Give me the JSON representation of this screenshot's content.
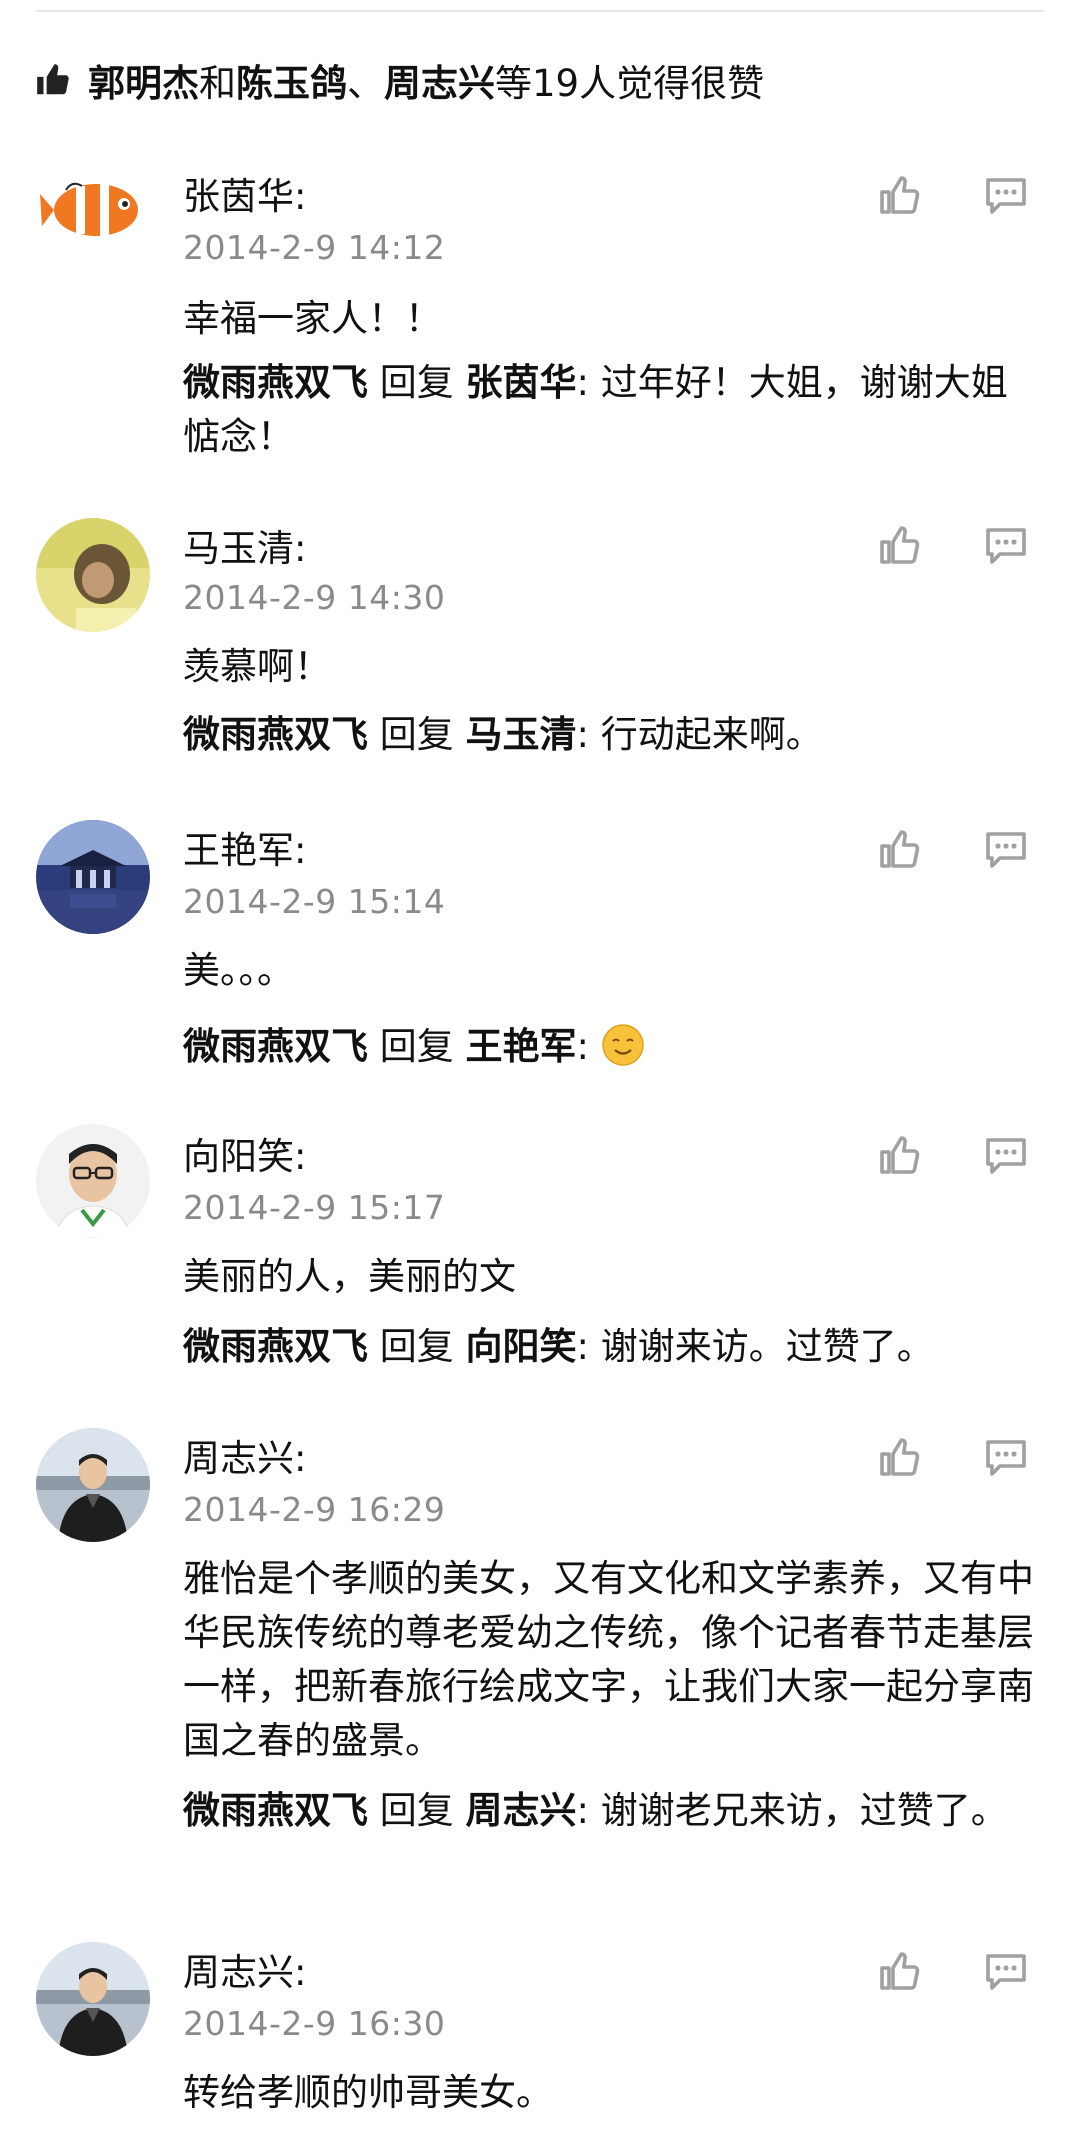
{
  "likes": {
    "names": "郭明杰和陈玉鸽、周志兴",
    "name1": "郭明杰",
    "and": "和",
    "name2": "陈玉鸽",
    "sep": "、",
    "name3": "周志兴",
    "suffix": "等19人觉得很赞",
    "icon": "thumbs-up-filled-icon"
  },
  "comments": [
    {
      "author": "张茵华:",
      "time": "2014-2-9 14:12",
      "text": "幸福一家人！！",
      "reply_from": "微雨燕双飞",
      "reply_word": "回复",
      "reply_to": "张茵华",
      "reply_text": ": 过年好！大姐，谢谢大姐惦念！",
      "avatar": "clownfish-avatar"
    },
    {
      "author": "马玉清:",
      "time": "2014-2-9 14:30",
      "text": "羡慕啊！",
      "reply_from": "微雨燕双飞",
      "reply_word": "回复",
      "reply_to": "马玉清",
      "reply_text": ": 行动起来啊。",
      "avatar": "yellow-photo-avatar"
    },
    {
      "author": "王艳军:",
      "time": "2014-2-9 15:14",
      "text": "美。。。",
      "reply_from": "微雨燕双飞",
      "reply_word": "回复",
      "reply_to": "王艳军",
      "reply_text": ":",
      "reply_emoji": "smile-emoji-icon",
      "avatar": "pavilion-avatar"
    },
    {
      "author": "向阳笑:",
      "time": "2014-2-9 15:17",
      "text": "美丽的人，美丽的文",
      "reply_from": "微雨燕双飞",
      "reply_word": "回复",
      "reply_to": "向阳笑",
      "reply_text": ": 谢谢来访。过赞了。",
      "avatar": "man-glasses-avatar"
    },
    {
      "author": "周志兴:",
      "time": "2014-2-9 16:29",
      "text": "雅怡是个孝顺的美女，又有文化和文学素养，又有中华民族传统的尊老爱幼之传统，像个记者春节走基层一样，把新春旅行绘成文字，让我们大家一起分享南国之春的盛景。",
      "reply_from": "微雨燕双飞",
      "reply_word": "回复",
      "reply_to": "周志兴",
      "reply_text": ": 谢谢老兄来访，过赞了。",
      "avatar": "man-coat-avatar"
    },
    {
      "author": "周志兴:",
      "time": "2014-2-9 16:30",
      "text": "转给孝顺的帅哥美女。",
      "avatar": "man-coat-avatar"
    }
  ],
  "icons": {
    "like": "thumbs-up-outline-icon",
    "reply": "comment-bubble-icon"
  },
  "colors": {
    "text": "#111111",
    "timestamp": "#8a8a8a",
    "icon": "#a0a0a0"
  }
}
